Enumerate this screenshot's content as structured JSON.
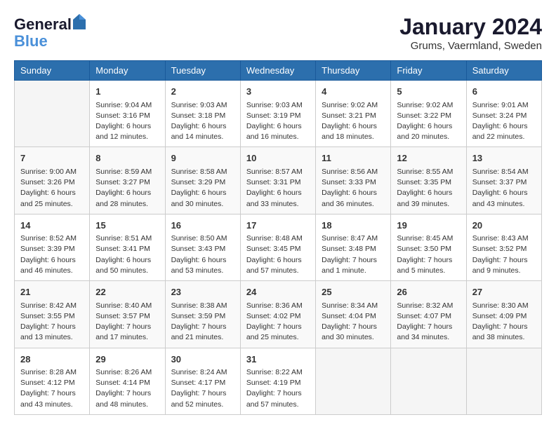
{
  "logo": {
    "line1": "General",
    "line2": "Blue"
  },
  "header": {
    "month_year": "January 2024",
    "location": "Grums, Vaermland, Sweden"
  },
  "weekdays": [
    "Sunday",
    "Monday",
    "Tuesday",
    "Wednesday",
    "Thursday",
    "Friday",
    "Saturday"
  ],
  "weeks": [
    [
      {
        "day": "",
        "info": ""
      },
      {
        "day": "1",
        "info": "Sunrise: 9:04 AM\nSunset: 3:16 PM\nDaylight: 6 hours\nand 12 minutes."
      },
      {
        "day": "2",
        "info": "Sunrise: 9:03 AM\nSunset: 3:18 PM\nDaylight: 6 hours\nand 14 minutes."
      },
      {
        "day": "3",
        "info": "Sunrise: 9:03 AM\nSunset: 3:19 PM\nDaylight: 6 hours\nand 16 minutes."
      },
      {
        "day": "4",
        "info": "Sunrise: 9:02 AM\nSunset: 3:21 PM\nDaylight: 6 hours\nand 18 minutes."
      },
      {
        "day": "5",
        "info": "Sunrise: 9:02 AM\nSunset: 3:22 PM\nDaylight: 6 hours\nand 20 minutes."
      },
      {
        "day": "6",
        "info": "Sunrise: 9:01 AM\nSunset: 3:24 PM\nDaylight: 6 hours\nand 22 minutes."
      }
    ],
    [
      {
        "day": "7",
        "info": "Sunrise: 9:00 AM\nSunset: 3:26 PM\nDaylight: 6 hours\nand 25 minutes."
      },
      {
        "day": "8",
        "info": "Sunrise: 8:59 AM\nSunset: 3:27 PM\nDaylight: 6 hours\nand 28 minutes."
      },
      {
        "day": "9",
        "info": "Sunrise: 8:58 AM\nSunset: 3:29 PM\nDaylight: 6 hours\nand 30 minutes."
      },
      {
        "day": "10",
        "info": "Sunrise: 8:57 AM\nSunset: 3:31 PM\nDaylight: 6 hours\nand 33 minutes."
      },
      {
        "day": "11",
        "info": "Sunrise: 8:56 AM\nSunset: 3:33 PM\nDaylight: 6 hours\nand 36 minutes."
      },
      {
        "day": "12",
        "info": "Sunrise: 8:55 AM\nSunset: 3:35 PM\nDaylight: 6 hours\nand 39 minutes."
      },
      {
        "day": "13",
        "info": "Sunrise: 8:54 AM\nSunset: 3:37 PM\nDaylight: 6 hours\nand 43 minutes."
      }
    ],
    [
      {
        "day": "14",
        "info": "Sunrise: 8:52 AM\nSunset: 3:39 PM\nDaylight: 6 hours\nand 46 minutes."
      },
      {
        "day": "15",
        "info": "Sunrise: 8:51 AM\nSunset: 3:41 PM\nDaylight: 6 hours\nand 50 minutes."
      },
      {
        "day": "16",
        "info": "Sunrise: 8:50 AM\nSunset: 3:43 PM\nDaylight: 6 hours\nand 53 minutes."
      },
      {
        "day": "17",
        "info": "Sunrise: 8:48 AM\nSunset: 3:45 PM\nDaylight: 6 hours\nand 57 minutes."
      },
      {
        "day": "18",
        "info": "Sunrise: 8:47 AM\nSunset: 3:48 PM\nDaylight: 7 hours\nand 1 minute."
      },
      {
        "day": "19",
        "info": "Sunrise: 8:45 AM\nSunset: 3:50 PM\nDaylight: 7 hours\nand 5 minutes."
      },
      {
        "day": "20",
        "info": "Sunrise: 8:43 AM\nSunset: 3:52 PM\nDaylight: 7 hours\nand 9 minutes."
      }
    ],
    [
      {
        "day": "21",
        "info": "Sunrise: 8:42 AM\nSunset: 3:55 PM\nDaylight: 7 hours\nand 13 minutes."
      },
      {
        "day": "22",
        "info": "Sunrise: 8:40 AM\nSunset: 3:57 PM\nDaylight: 7 hours\nand 17 minutes."
      },
      {
        "day": "23",
        "info": "Sunrise: 8:38 AM\nSunset: 3:59 PM\nDaylight: 7 hours\nand 21 minutes."
      },
      {
        "day": "24",
        "info": "Sunrise: 8:36 AM\nSunset: 4:02 PM\nDaylight: 7 hours\nand 25 minutes."
      },
      {
        "day": "25",
        "info": "Sunrise: 8:34 AM\nSunset: 4:04 PM\nDaylight: 7 hours\nand 30 minutes."
      },
      {
        "day": "26",
        "info": "Sunrise: 8:32 AM\nSunset: 4:07 PM\nDaylight: 7 hours\nand 34 minutes."
      },
      {
        "day": "27",
        "info": "Sunrise: 8:30 AM\nSunset: 4:09 PM\nDaylight: 7 hours\nand 38 minutes."
      }
    ],
    [
      {
        "day": "28",
        "info": "Sunrise: 8:28 AM\nSunset: 4:12 PM\nDaylight: 7 hours\nand 43 minutes."
      },
      {
        "day": "29",
        "info": "Sunrise: 8:26 AM\nSunset: 4:14 PM\nDaylight: 7 hours\nand 48 minutes."
      },
      {
        "day": "30",
        "info": "Sunrise: 8:24 AM\nSunset: 4:17 PM\nDaylight: 7 hours\nand 52 minutes."
      },
      {
        "day": "31",
        "info": "Sunrise: 8:22 AM\nSunset: 4:19 PM\nDaylight: 7 hours\nand 57 minutes."
      },
      {
        "day": "",
        "info": ""
      },
      {
        "day": "",
        "info": ""
      },
      {
        "day": "",
        "info": ""
      }
    ]
  ]
}
